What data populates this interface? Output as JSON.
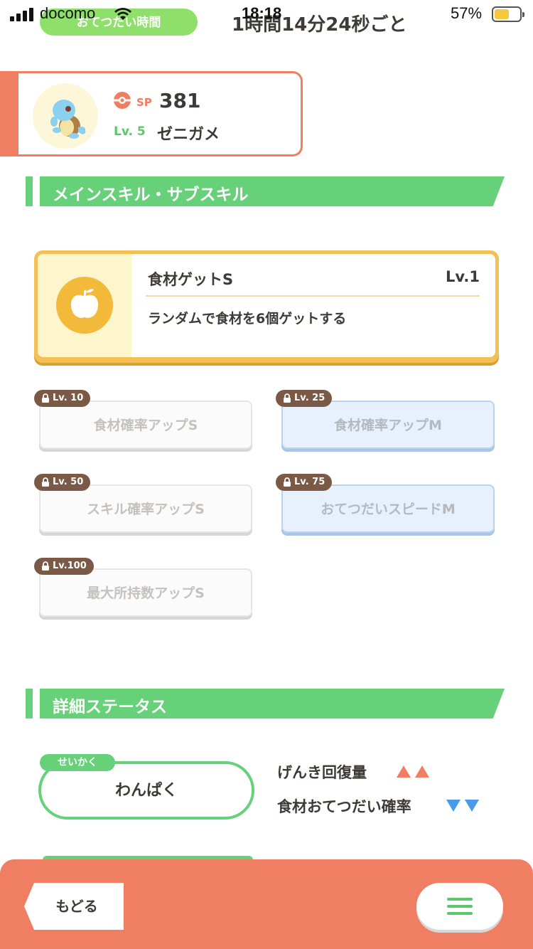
{
  "status_bar": {
    "carrier": "docomo",
    "time": "18:18",
    "battery_percent": "57%"
  },
  "header": {
    "help_time_label": "おてつだい時間",
    "help_time_value": "1時間14分24秒ごと"
  },
  "pokemon": {
    "sp_label": "SP",
    "sp_value": "381",
    "level": "Lv. 5",
    "name": "ゼニガメ"
  },
  "sections": {
    "skills_title": "メインスキル・サブスキル",
    "status_title": "詳細ステータス"
  },
  "main_skill": {
    "name": "食材ゲットS",
    "level": "Lv.1",
    "description": "ランダムで食材を6個ゲットする",
    "icon": "apple-icon"
  },
  "sub_skills": [
    {
      "unlock": "Lv. 10",
      "name": "食材確率アップS",
      "style": "white"
    },
    {
      "unlock": "Lv. 25",
      "name": "食材確率アップM",
      "style": "blue"
    },
    {
      "unlock": "Lv. 50",
      "name": "スキル確率アップS",
      "style": "white"
    },
    {
      "unlock": "Lv. 75",
      "name": "おてつだいスピードM",
      "style": "blue"
    },
    {
      "unlock": "Lv.100",
      "name": "最大所持数アップS",
      "style": "white"
    }
  ],
  "nature": {
    "tag": "せいかく",
    "value": "わんぱく",
    "effects": [
      {
        "label": "げんき回復量",
        "direction": "up",
        "count": 2,
        "color": "#ef7e62"
      },
      {
        "label": "食材おてつだい確率",
        "direction": "down",
        "count": 2,
        "color": "#4a9ae8"
      }
    ]
  },
  "bottom_bar": {
    "back_label": "もどる",
    "menu_icon": "hamburger-menu-icon"
  },
  "colors": {
    "accent_green": "#66d178",
    "accent_orange": "#ef7e62",
    "skill_gold": "#f3c056"
  }
}
